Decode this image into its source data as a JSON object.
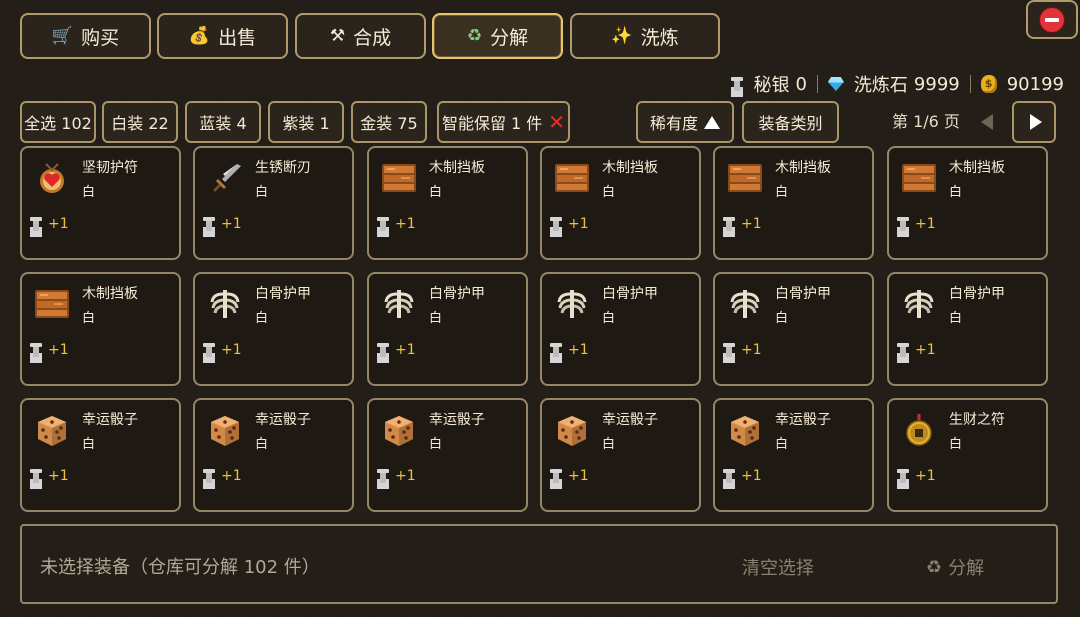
{
  "tabs": [
    {
      "icon": "cart-icon",
      "glyph": "🛒",
      "label": "购买"
    },
    {
      "icon": "money-bag-icon",
      "glyph": "💰",
      "label": "出售"
    },
    {
      "icon": "hammer-pick-icon",
      "glyph": "⚒",
      "label": "合成"
    },
    {
      "icon": "recycle-icon",
      "glyph": "♻",
      "label": "分解",
      "active": true
    },
    {
      "icon": "sparkles-icon",
      "glyph": "✨",
      "label": "洗炼"
    }
  ],
  "currency": {
    "mithril_label": "秘银",
    "mithril_value": "0",
    "stone_label": "洗炼石",
    "stone_value": "9999",
    "gold_value": "90199"
  },
  "filters": {
    "all": "全选 102",
    "white": "白装 22",
    "blue": "蓝装 4",
    "purple": "紫装 1",
    "gold": "金装 75",
    "smart_keep": "智能保留 1 件",
    "sort_rarity": "稀有度",
    "equip_type": "装备类别"
  },
  "pagination": {
    "label": "第 1/6 页"
  },
  "items": [
    {
      "name": "坚韧护符",
      "rarity": "白",
      "yield": "+1",
      "icon": "amulet-icon"
    },
    {
      "name": "生锈断刃",
      "rarity": "白",
      "yield": "+1",
      "icon": "sword-icon"
    },
    {
      "name": "木制挡板",
      "rarity": "白",
      "yield": "+1",
      "icon": "wooden-plank-icon"
    },
    {
      "name": "木制挡板",
      "rarity": "白",
      "yield": "+1",
      "icon": "wooden-plank-icon"
    },
    {
      "name": "木制挡板",
      "rarity": "白",
      "yield": "+1",
      "icon": "wooden-plank-icon"
    },
    {
      "name": "木制挡板",
      "rarity": "白",
      "yield": "+1",
      "icon": "wooden-plank-icon"
    },
    {
      "name": "木制挡板",
      "rarity": "白",
      "yield": "+1",
      "icon": "wooden-plank-icon"
    },
    {
      "name": "白骨护甲",
      "rarity": "白",
      "yield": "+1",
      "icon": "ribcage-icon"
    },
    {
      "name": "白骨护甲",
      "rarity": "白",
      "yield": "+1",
      "icon": "ribcage-icon"
    },
    {
      "name": "白骨护甲",
      "rarity": "白",
      "yield": "+1",
      "icon": "ribcage-icon"
    },
    {
      "name": "白骨护甲",
      "rarity": "白",
      "yield": "+1",
      "icon": "ribcage-icon"
    },
    {
      "name": "白骨护甲",
      "rarity": "白",
      "yield": "+1",
      "icon": "ribcage-icon"
    },
    {
      "name": "幸运骰子",
      "rarity": "白",
      "yield": "+1",
      "icon": "dice-icon"
    },
    {
      "name": "幸运骰子",
      "rarity": "白",
      "yield": "+1",
      "icon": "dice-icon"
    },
    {
      "name": "幸运骰子",
      "rarity": "白",
      "yield": "+1",
      "icon": "dice-icon"
    },
    {
      "name": "幸运骰子",
      "rarity": "白",
      "yield": "+1",
      "icon": "dice-icon"
    },
    {
      "name": "幸运骰子",
      "rarity": "白",
      "yield": "+1",
      "icon": "dice-icon"
    },
    {
      "name": "生财之符",
      "rarity": "白",
      "yield": "+1",
      "icon": "coin-charm-icon"
    }
  ],
  "footer": {
    "status": "未选择装备（仓库可分解 102 件）",
    "clear": "清空选择",
    "decompose": "分解"
  },
  "colors": {
    "accent_gold": "#e8c56a",
    "yield_text": "#f0c040",
    "close_red": "#e2323a",
    "border": "#958766"
  }
}
